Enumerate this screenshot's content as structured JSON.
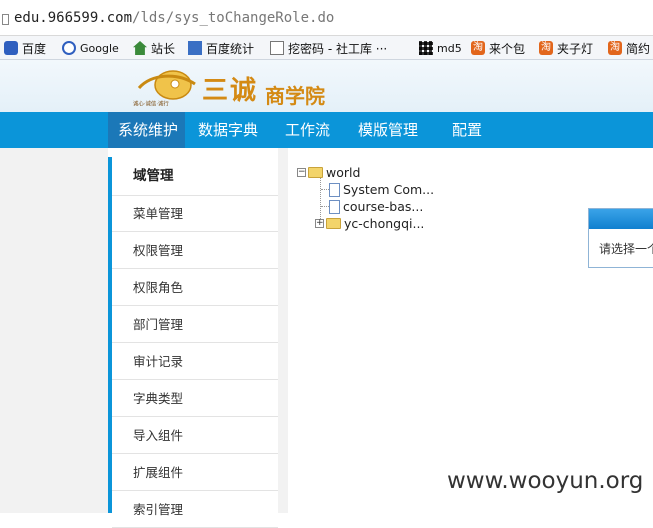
{
  "browser": {
    "url_host": "edu.966599.com",
    "url_path": "/lds/sys_toChangeRole.do",
    "bookmarks": [
      {
        "label": "百度",
        "icon": "baidu-paw-icon"
      },
      {
        "label": "Google",
        "icon": "google-icon"
      },
      {
        "label": "站长",
        "icon": "house-icon"
      },
      {
        "label": "百度统计",
        "icon": "stats-icon"
      },
      {
        "label": "挖密码 - 社工库 ···",
        "icon": "page-icon"
      },
      {
        "label": "md5",
        "icon": "grid-icon"
      },
      {
        "label": "来个包",
        "icon": "taobao-icon"
      },
      {
        "label": "夹子灯",
        "icon": "taobao-icon"
      },
      {
        "label": "简约",
        "icon": "taobao-icon"
      }
    ]
  },
  "header": {
    "logo_title": "三诚",
    "logo_subtitle": "商学院",
    "logo_tagline": "诚心·诚信·诚行"
  },
  "nav": {
    "items": [
      {
        "label": "系统维护",
        "active": true
      },
      {
        "label": "数据字典",
        "active": false
      },
      {
        "label": "工作流",
        "active": false
      },
      {
        "label": "模版管理",
        "active": false
      },
      {
        "label": "配置",
        "active": false
      }
    ]
  },
  "sidebar": {
    "items": [
      {
        "label": "域管理",
        "active": true
      },
      {
        "label": "菜单管理",
        "active": false
      },
      {
        "label": "权限管理",
        "active": false
      },
      {
        "label": "权限角色",
        "active": false
      },
      {
        "label": "部门管理",
        "active": false
      },
      {
        "label": "审计记录",
        "active": false
      },
      {
        "label": "字典类型",
        "active": false
      },
      {
        "label": "导入组件",
        "active": false
      },
      {
        "label": "扩展组件",
        "active": false
      },
      {
        "label": "索引管理",
        "active": false
      }
    ]
  },
  "tree": {
    "root": "world",
    "children": [
      {
        "label": "System Com...",
        "type": "file"
      },
      {
        "label": "course-bas...",
        "type": "file"
      },
      {
        "label": "yc-chongqi...",
        "type": "folder",
        "expandable": true
      }
    ]
  },
  "dialog": {
    "text": "请选择一个"
  },
  "watermark": "www.wooyun.org",
  "colors": {
    "nav_blue": "#0b95d9",
    "nav_active": "#1b78b8",
    "logo_gold": "#d4a020"
  }
}
